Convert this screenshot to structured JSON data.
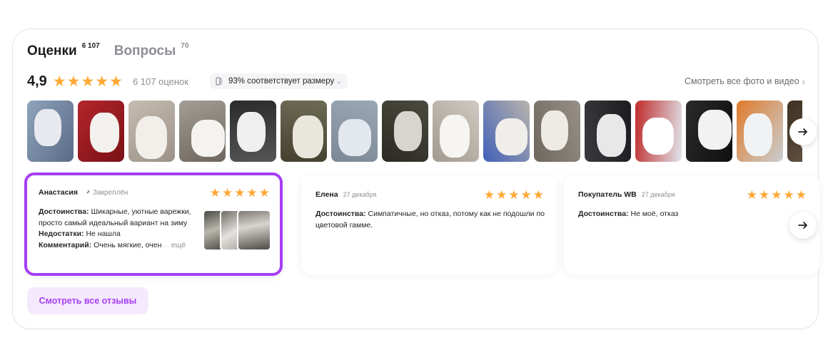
{
  "tabs": [
    {
      "label": "Оценки",
      "count": "6 107",
      "active": true
    },
    {
      "label": "Вопросы",
      "count": "70",
      "active": false
    }
  ],
  "rating": {
    "value": "4,9",
    "stars": 5,
    "count_label": "6 107 оценок",
    "size_fit": "93% соответствует размеру",
    "see_all_photos": "Смотреть все фото и видео"
  },
  "photos": [
    {
      "icon": "photo-mitten-in-snow"
    },
    {
      "icon": "photo-white-mittens-red-background"
    },
    {
      "icon": "photo-white-mittens-on-table"
    },
    {
      "icon": "photo-fluffy-mittens-closeup"
    },
    {
      "icon": "photo-mittens-pair-dark-background"
    },
    {
      "icon": "photo-mitten-on-carpet"
    },
    {
      "icon": "photo-grey-mitten-on-bed"
    },
    {
      "icon": "photo-mitten-on-desk"
    },
    {
      "icon": "photo-white-mitten-on-hand"
    },
    {
      "icon": "photo-mitten-with-tag"
    },
    {
      "icon": "photo-mittens-with-label"
    },
    {
      "icon": "photo-black-and-white-mittens"
    },
    {
      "icon": "photo-person-in-winter"
    },
    {
      "icon": "photo-mitten-on-dark-background"
    },
    {
      "icon": "photo-mittens-in-package"
    },
    {
      "icon": "photo-partial-mitten"
    }
  ],
  "reviews": [
    {
      "name": "Анастасия",
      "pinned_label": "Закреплён",
      "stars": 5,
      "pros_label": "Достоинства:",
      "pros": "Шикарные, уютные варежки, просто самый идеальный вариант на зиму",
      "cons_label": "Недостатки:",
      "cons": "Не нашла",
      "comment_label": "Комментарий:",
      "comment": "Очень мягкие, очен",
      "more": "ещё"
    },
    {
      "name": "Елена",
      "date": "27 декабря",
      "stars": 5,
      "pros_label": "Достоинства:",
      "pros": "Симпатичные, но отказ, потому как не подошли по цветовой гамме."
    },
    {
      "name": "Покупатель WB",
      "date": "27 декабря",
      "stars": 5,
      "pros_label": "Достоинства:",
      "pros": "Не моё, отказ"
    }
  ],
  "all_reviews_button": "Смотреть все отзывы",
  "colors": {
    "accent": "#a73ef4",
    "star": "#ffa836",
    "muted": "#8d8d95"
  }
}
